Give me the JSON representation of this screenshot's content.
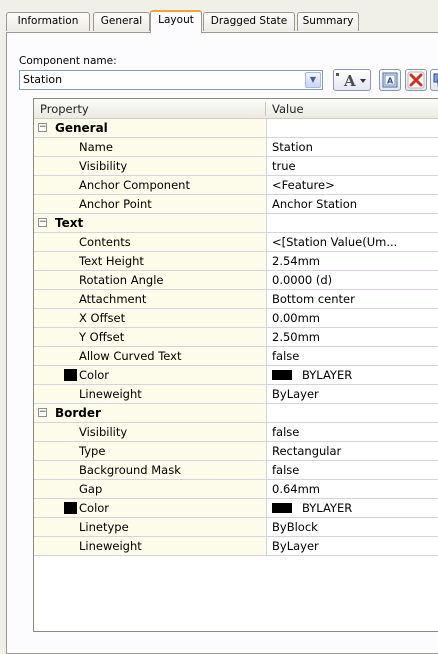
{
  "tabs": [
    {
      "label": "Information",
      "active": false
    },
    {
      "label": "General",
      "active": false
    },
    {
      "label": "Layout",
      "active": true
    },
    {
      "label": "Dragged State",
      "active": false
    },
    {
      "label": "Summary",
      "active": false
    }
  ],
  "component": {
    "label": "Component name:",
    "value": "Station"
  },
  "toolbar": {
    "text_button": "A",
    "icons": [
      "text-style-icon",
      "copy-component-icon",
      "delete-icon",
      "move-icon"
    ]
  },
  "grid": {
    "header": {
      "property": "Property",
      "value": "Value"
    },
    "groups": [
      {
        "name": "General",
        "rows": [
          {
            "label": "Name",
            "value": "Station"
          },
          {
            "label": "Visibility",
            "value": "true"
          },
          {
            "label": "Anchor Component",
            "value": "<Feature>"
          },
          {
            "label": "Anchor Point",
            "value": "Anchor Station"
          }
        ]
      },
      {
        "name": "Text",
        "rows": [
          {
            "label": "Contents",
            "value": "<[Station Value(Um..."
          },
          {
            "label": "Text Height",
            "value": "2.54mm"
          },
          {
            "label": "Rotation Angle",
            "value": "0.0000 (d)"
          },
          {
            "label": "Attachment",
            "value": "Bottom center"
          },
          {
            "label": "X Offset",
            "value": "0.00mm"
          },
          {
            "label": "Y Offset",
            "value": "2.50mm"
          },
          {
            "label": "Allow Curved Text",
            "value": "false"
          },
          {
            "label": "Color",
            "value": "BYLAYER"
          },
          {
            "label": "Lineweight",
            "value": "ByLayer"
          }
        ]
      },
      {
        "name": "Border",
        "rows": [
          {
            "label": "Visibility",
            "value": "false"
          },
          {
            "label": "Type",
            "value": "Rectangular"
          },
          {
            "label": "Background Mask",
            "value": "false"
          },
          {
            "label": "Gap",
            "value": "0.64mm"
          },
          {
            "label": "Color",
            "value": "BYLAYER"
          },
          {
            "label": "Linetype",
            "value": "ByBlock"
          },
          {
            "label": "Lineweight",
            "value": "ByLayer"
          }
        ]
      }
    ],
    "expander_symbol": "−",
    "swatch_color": "#000000"
  },
  "colors": {
    "active_tab_accent": "#f1a33a",
    "label_column_bg": "#fdfcea",
    "delete_red": "#d32f1f"
  }
}
